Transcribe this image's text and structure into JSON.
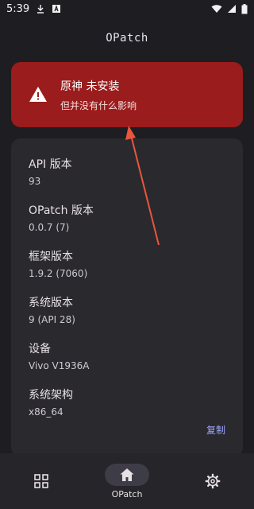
{
  "status_bar": {
    "time": "5:39",
    "icons_left": [
      "download-icon",
      "app-a-icon"
    ],
    "icons_right": [
      "wifi-icon",
      "signal-icon",
      "battery-icon"
    ]
  },
  "app_title": "OPatch",
  "warning": {
    "title": "原神 未安装",
    "subtitle": "但并没有什么影响",
    "icon": "warning-triangle-icon",
    "color": "#9a1c1c"
  },
  "info": [
    {
      "label": "API 版本",
      "value": "93"
    },
    {
      "label": "OPatch 版本",
      "value": "0.0.7 (7)"
    },
    {
      "label": "框架版本",
      "value": "1.9.2 (7060)"
    },
    {
      "label": "系统版本",
      "value": "9 (API 28)"
    },
    {
      "label": "设备",
      "value": "Vivo V1936A"
    },
    {
      "label": "系统架构",
      "value": "x86_64"
    }
  ],
  "copy_label": "复制",
  "bottom_nav": {
    "items": [
      {
        "icon": "modules-grid-icon"
      },
      {
        "icon": "home-icon",
        "label": "OPatch",
        "active": true
      },
      {
        "icon": "settings-gear-icon"
      }
    ]
  },
  "colors": {
    "background": "#1e1d21",
    "card": "#2a292e",
    "accent": "#9fa6ff",
    "annotation_arrow": "#e8573c"
  }
}
